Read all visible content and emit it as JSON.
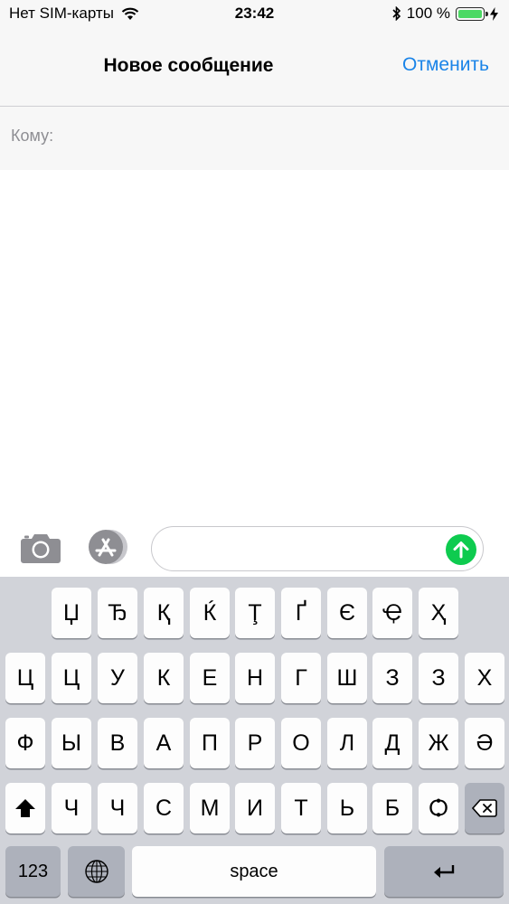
{
  "status_bar": {
    "carrier": "Нет SIM-карты",
    "time": "23:42",
    "battery": "100 %"
  },
  "nav": {
    "title": "Новое сообщение",
    "cancel": "Отменить"
  },
  "recipient": {
    "label": "Кому:"
  },
  "message": {
    "value": ""
  },
  "keyboard": {
    "row1": [
      "Џ",
      "Ђ",
      "Қ",
      "Ќ",
      "Ţ",
      "Ґ",
      "Є",
      "Ҿ",
      "Ҳ"
    ],
    "row2": [
      "Ц",
      "Ц",
      "У",
      "К",
      "Е",
      "Н",
      "Г",
      "Ш",
      "З",
      "З",
      "Х"
    ],
    "row3": [
      "Ф",
      "Ы",
      "В",
      "А",
      "П",
      "Р",
      "О",
      "Л",
      "Д",
      "Ж",
      "Ә"
    ],
    "row4": [
      "Ч",
      "Ч",
      "С",
      "М",
      "И",
      "Т",
      "Ь",
      "Б",
      "Ѻ"
    ],
    "numbers": "123",
    "space": "space",
    "icons": [
      "shift-icon",
      "backspace-icon",
      "globe-icon",
      "return-icon"
    ]
  },
  "colors": {
    "accent": "#1a84e8",
    "send": "#0ecb4f",
    "keyboard_bg": "#d1d3d9"
  }
}
